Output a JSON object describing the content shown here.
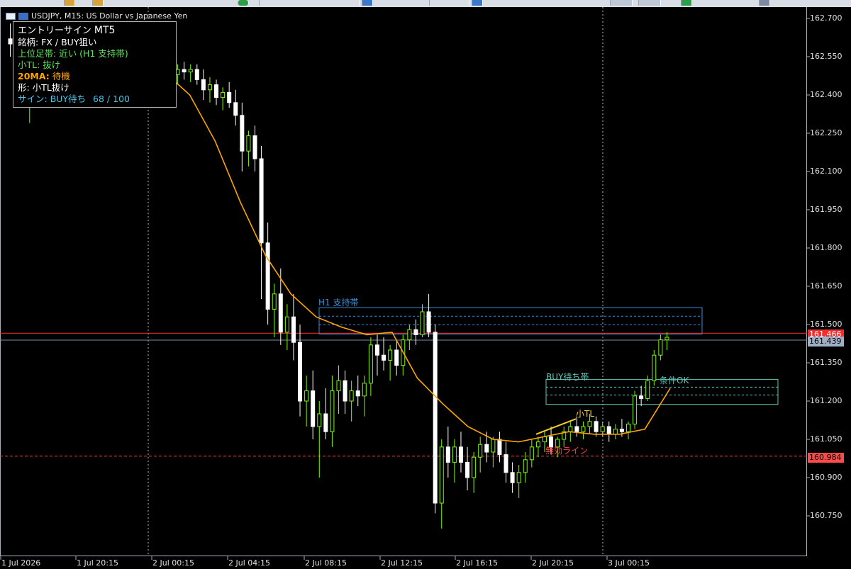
{
  "header": {
    "symbol_line": "USDJPY, M15:  US Dollar vs Japanese Yen"
  },
  "info_panel": {
    "title": "エントリーサイン",
    "title_suffix": "MT5",
    "symbol_label": "銘柄: FX / BUY狙い",
    "higher_tf": "上位足帯: 近い (H1 支持帯)",
    "small_tl": "小TL: 抜け",
    "ma20_label": "20MA:",
    "ma20_value": " 待機",
    "shape": "形: 小TL抜け",
    "sign_label": "サイン:",
    "sign_value": " BUY待ち",
    "score": "68 / 100"
  },
  "annotations": {
    "h1_zone": "H1 支持帯",
    "buy_zone": "BUY待ち帯",
    "small_tl": "小TL",
    "invalid_line": "無効ライン",
    "condition_ok": "条件OK"
  },
  "price_tags": {
    "bid": "161.466",
    "last": "161.439",
    "invalid": "160.984"
  },
  "colors": {
    "bull": "#7cfc00",
    "bear": "#ffffff",
    "ma": "#ffa500",
    "h1_zone": "#3a8ed8",
    "buy_zone": "#5ec7b8",
    "invalid": "#ff4040",
    "bid_line": "#ff3030",
    "last_line": "#7a8ea8"
  },
  "chart_data": {
    "type": "candlestick",
    "symbol": "USDJPY",
    "timeframe": "M15",
    "ylim": [
      160.6,
      162.74
    ],
    "y_ticks": [
      "162.700",
      "162.550",
      "162.400",
      "162.250",
      "162.100",
      "161.950",
      "161.800",
      "161.650",
      "161.500",
      "161.350",
      "161.200",
      "161.050",
      "160.900",
      "160.750"
    ],
    "x_ticks": [
      "1 Jul 2026",
      "1 Jul 20:15",
      "2 Jul 00:15",
      "2 Jul 04:15",
      "2 Jul 08:15",
      "2 Jul 12:15",
      "2 Jul 16:15",
      "2 Jul 20:15",
      "3 Jul 00:15"
    ],
    "separators": [
      "2 Jul 00:00",
      "3 Jul 00:00"
    ],
    "grid": false,
    "series": [
      {
        "name": "20MA",
        "values": [
          162.66,
          162.62,
          162.57,
          162.55,
          162.54,
          162.52,
          162.49,
          162.4,
          162.22,
          161.98,
          161.77,
          161.62,
          161.53,
          161.49,
          161.46,
          161.47,
          161.29,
          161.19,
          161.1,
          161.05,
          161.04,
          161.06,
          161.08,
          161.07,
          161.07,
          161.09,
          161.25
        ]
      }
    ],
    "levels": {
      "bid": 161.466,
      "last": 161.439,
      "invalid": 160.984,
      "h1_zone": [
        161.463,
        161.566
      ],
      "buy_zone": [
        161.187,
        161.285
      ],
      "small_tl": [
        161.07,
        161.13
      ]
    },
    "candles_ohlc": [
      [
        162.62,
        162.68,
        162.55,
        162.6
      ],
      [
        162.6,
        162.63,
        162.48,
        162.52
      ],
      [
        162.52,
        162.58,
        162.35,
        162.4
      ],
      [
        162.4,
        162.5,
        162.29,
        162.45
      ],
      [
        162.45,
        162.53,
        162.36,
        162.48
      ],
      [
        162.48,
        162.56,
        162.41,
        162.5
      ],
      [
        162.5,
        162.54,
        162.4,
        162.44
      ],
      [
        162.44,
        162.52,
        162.39,
        162.47
      ],
      [
        162.47,
        162.55,
        162.42,
        162.51
      ],
      [
        162.51,
        162.57,
        162.46,
        162.53
      ],
      [
        162.53,
        162.58,
        162.48,
        162.5
      ],
      [
        162.5,
        162.55,
        162.45,
        162.53
      ],
      [
        162.53,
        162.57,
        162.48,
        162.55
      ],
      [
        162.55,
        162.59,
        162.5,
        162.52
      ],
      [
        162.52,
        162.57,
        162.48,
        162.55
      ],
      [
        162.55,
        162.6,
        162.5,
        162.53
      ],
      [
        162.53,
        162.57,
        162.5,
        162.55
      ],
      [
        162.55,
        162.57,
        162.51,
        162.53
      ],
      [
        162.53,
        162.56,
        162.49,
        162.54
      ],
      [
        162.54,
        162.56,
        162.5,
        162.52
      ],
      [
        162.52,
        162.55,
        162.49,
        162.53
      ],
      [
        162.53,
        162.56,
        162.5,
        162.51
      ],
      [
        162.51,
        162.55,
        162.47,
        162.53
      ],
      [
        162.53,
        162.55,
        162.49,
        162.51
      ],
      [
        162.51,
        162.54,
        162.48,
        162.52
      ],
      [
        162.52,
        162.54,
        162.46,
        162.48
      ],
      [
        162.48,
        162.52,
        162.44,
        162.5
      ],
      [
        162.5,
        162.53,
        162.46,
        162.49
      ],
      [
        162.49,
        162.52,
        162.45,
        162.5
      ],
      [
        162.5,
        162.52,
        162.44,
        162.46
      ],
      [
        162.46,
        162.5,
        162.38,
        162.42
      ],
      [
        162.42,
        162.47,
        162.37,
        162.44
      ],
      [
        162.44,
        162.46,
        162.36,
        162.39
      ],
      [
        162.39,
        162.43,
        162.34,
        162.41
      ],
      [
        162.41,
        162.45,
        162.35,
        162.37
      ],
      [
        162.37,
        162.42,
        162.28,
        162.32
      ],
      [
        162.32,
        162.37,
        162.1,
        162.18
      ],
      [
        162.18,
        162.26,
        162.12,
        162.24
      ],
      [
        162.24,
        162.28,
        162.1,
        162.15
      ],
      [
        162.15,
        162.2,
        161.6,
        161.82
      ],
      [
        161.82,
        161.9,
        161.5,
        161.56
      ],
      [
        161.56,
        161.66,
        161.45,
        161.62
      ],
      [
        161.62,
        161.72,
        161.42,
        161.47
      ],
      [
        161.47,
        161.58,
        161.4,
        161.53
      ],
      [
        161.53,
        161.62,
        161.36,
        161.43
      ],
      [
        161.43,
        161.5,
        161.14,
        161.2
      ],
      [
        161.2,
        161.3,
        161.1,
        161.24
      ],
      [
        161.24,
        161.32,
        161.05,
        161.1
      ],
      [
        161.1,
        161.2,
        160.9,
        161.15
      ],
      [
        161.15,
        161.25,
        161.05,
        161.08
      ],
      [
        161.08,
        161.3,
        161.02,
        161.24
      ],
      [
        161.24,
        161.34,
        161.15,
        161.28
      ],
      [
        161.28,
        161.32,
        161.15,
        161.2
      ],
      [
        161.2,
        161.28,
        161.12,
        161.24
      ],
      [
        161.24,
        161.3,
        161.18,
        161.22
      ],
      [
        161.22,
        161.3,
        161.14,
        161.27
      ],
      [
        161.27,
        161.45,
        161.22,
        161.42
      ],
      [
        161.42,
        161.46,
        161.3,
        161.38
      ],
      [
        161.38,
        161.45,
        161.32,
        161.36
      ],
      [
        161.36,
        161.42,
        161.28,
        161.4
      ],
      [
        161.4,
        161.44,
        161.3,
        161.34
      ],
      [
        161.34,
        161.46,
        161.3,
        161.44
      ],
      [
        161.44,
        161.5,
        161.4,
        161.48
      ],
      [
        161.48,
        161.52,
        161.42,
        161.46
      ],
      [
        161.46,
        161.58,
        161.45,
        161.55
      ],
      [
        161.55,
        161.62,
        161.45,
        161.47
      ],
      [
        161.47,
        161.5,
        160.76,
        160.8
      ],
      [
        160.8,
        161.05,
        160.7,
        161.02
      ],
      [
        161.02,
        161.1,
        160.9,
        160.96
      ],
      [
        160.96,
        161.05,
        160.88,
        161.02
      ],
      [
        161.02,
        161.08,
        160.92,
        160.96
      ],
      [
        160.96,
        161.02,
        160.85,
        160.9
      ],
      [
        160.9,
        161.0,
        160.84,
        160.98
      ],
      [
        160.98,
        161.06,
        160.92,
        161.03
      ],
      [
        161.03,
        161.08,
        160.96,
        161.0
      ],
      [
        161.0,
        161.06,
        160.94,
        161.05
      ],
      [
        161.05,
        161.08,
        160.96,
        160.99
      ],
      [
        160.99,
        161.04,
        160.88,
        160.92
      ],
      [
        160.92,
        160.96,
        160.84,
        160.88
      ],
      [
        160.88,
        160.95,
        160.82,
        160.92
      ],
      [
        160.92,
        161.0,
        160.88,
        160.97
      ],
      [
        160.97,
        161.05,
        160.94,
        161.02
      ],
      [
        161.02,
        161.06,
        160.98,
        161.04
      ],
      [
        161.04,
        161.08,
        161.0,
        161.06
      ],
      [
        161.06,
        161.1,
        160.99,
        161.02
      ],
      [
        161.02,
        161.06,
        160.98,
        161.05
      ],
      [
        161.05,
        161.1,
        161.02,
        161.08
      ],
      [
        161.08,
        161.12,
        161.04,
        161.1
      ],
      [
        161.1,
        161.14,
        161.06,
        161.08
      ],
      [
        161.08,
        161.12,
        161.05,
        161.1
      ],
      [
        161.1,
        161.15,
        161.07,
        161.12
      ],
      [
        161.12,
        161.14,
        161.06,
        161.08
      ],
      [
        161.08,
        161.12,
        161.06,
        161.1
      ],
      [
        161.1,
        161.12,
        161.04,
        161.07
      ],
      [
        161.07,
        161.11,
        161.05,
        161.09
      ],
      [
        161.09,
        161.13,
        161.06,
        161.08
      ],
      [
        161.08,
        161.12,
        161.05,
        161.11
      ],
      [
        161.11,
        161.24,
        161.09,
        161.22
      ],
      [
        161.22,
        161.26,
        161.18,
        161.21
      ],
      [
        161.21,
        161.3,
        161.2,
        161.28
      ],
      [
        161.28,
        161.4,
        161.26,
        161.38
      ],
      [
        161.38,
        161.46,
        161.36,
        161.44
      ],
      [
        161.44,
        161.47,
        161.4,
        161.45
      ]
    ]
  }
}
